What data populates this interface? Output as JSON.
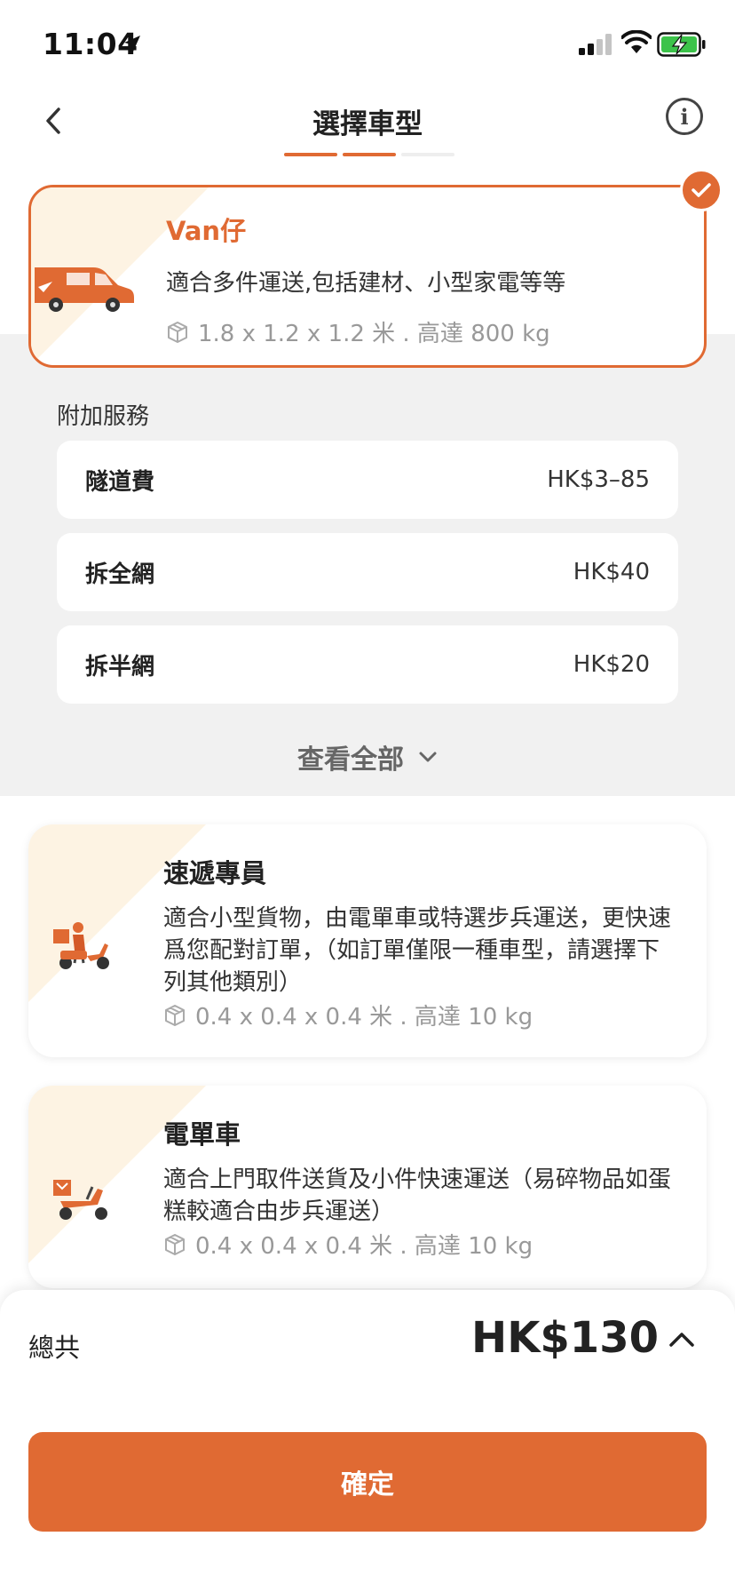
{
  "status_bar": {
    "time": "11:04"
  },
  "header": {
    "title": "選擇車型",
    "progress_steps": 3,
    "progress_active": 2
  },
  "selected_vehicle": {
    "title": "Van仔",
    "description": "適合多件運送,包括建材、小型家電等等",
    "spec": "1.8 x 1.2 x 1.2 米 . 高達 800 kg"
  },
  "addons": {
    "title": "附加服務",
    "items": [
      {
        "name": "隧道費",
        "price": "HK$3–85"
      },
      {
        "name": "拆全網",
        "price": "HK$40"
      },
      {
        "name": "拆半網",
        "price": "HK$20"
      }
    ],
    "view_all": "查看全部"
  },
  "vehicles": [
    {
      "title": "速遞專員",
      "description": "適合小型貨物，由電單車或特選步兵運送，更快速爲您配對訂單，（如訂單僅限一種車型，請選擇下列其他類別）",
      "spec": "0.4 x 0.4 x 0.4 米 . 高達 10 kg"
    },
    {
      "title": "電單車",
      "description": "適合上門取件送貨及小件快速運送（易碎物品如蛋糕較適合由步兵運送）",
      "spec": "0.4 x 0.4 x 0.4 米 . 高達 10 kg"
    }
  ],
  "total": {
    "label": "總共",
    "amount": "HK$130"
  },
  "confirm_label": "確定",
  "colors": {
    "accent": "#e06a33",
    "corner_tint": "#fdf3e3",
    "background_grey": "#f1f1f1"
  }
}
